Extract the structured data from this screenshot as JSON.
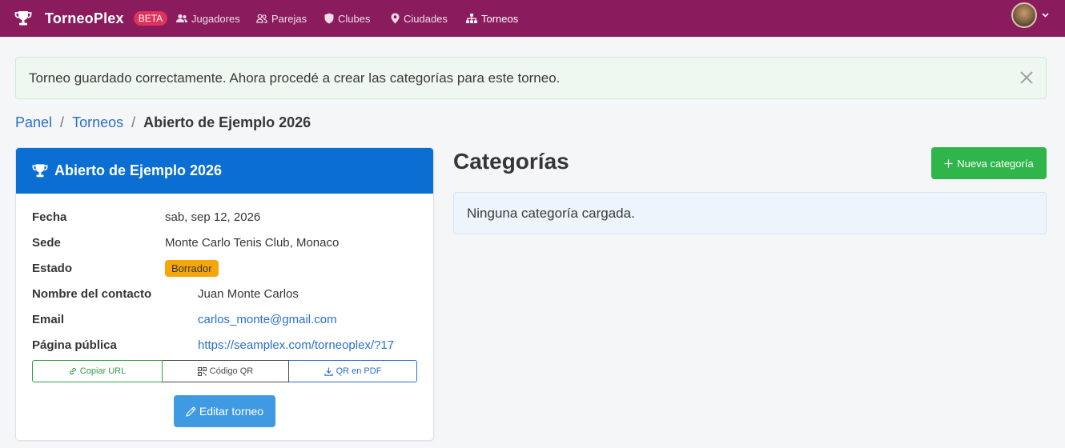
{
  "navbar": {
    "brand": "TorneoPlex",
    "beta": "BETA",
    "items": [
      {
        "label": "Jugadores",
        "icon": "users-icon"
      },
      {
        "label": "Parejas",
        "icon": "user-pair-icon"
      },
      {
        "label": "Clubes",
        "icon": "shield-icon"
      },
      {
        "label": "Ciudades",
        "icon": "map-pin-icon"
      },
      {
        "label": "Torneos",
        "icon": "sitemap-icon"
      }
    ],
    "colors": {
      "bar": "#8a1c5e",
      "beta": "#e0325c"
    }
  },
  "alert": {
    "message": "Torneo guardado correctamente. Ahora procedé a crear las categorías para este torneo."
  },
  "breadcrumb": {
    "items": [
      "Panel",
      "Torneos"
    ],
    "separator": "/",
    "current": "Abierto de Ejemplo 2026"
  },
  "tournament": {
    "title": "Abierto de Ejemplo 2026",
    "fields": {
      "fecha": {
        "label": "Fecha",
        "value": "sab, sep 12, 2026"
      },
      "sede": {
        "label": "Sede",
        "value": "Monte Carlo Tenis Club, Monaco"
      },
      "estado": {
        "label": "Estado",
        "value": "Borrador"
      },
      "contacto": {
        "label": "Nombre del contacto",
        "value": "Juan Monte Carlos"
      },
      "email": {
        "label": "Email",
        "value": "carlos_monte@gmail.com"
      },
      "pagina": {
        "label": "Página pública",
        "value": "https://seamplex.com/torneoplex/?17"
      }
    },
    "actions": {
      "copy_url": "Copiar URL",
      "qr_code": "Código QR",
      "qr_pdf": "QR en PDF",
      "edit": "Editar torneo"
    },
    "colors": {
      "header": "#0b6ed2",
      "badge": "#f5a70a",
      "edit": "#3f9ae3"
    }
  },
  "categories": {
    "title": "Categorías",
    "new_button": "Nueva categoría",
    "empty": "Ninguna categoría cargada.",
    "colors": {
      "new_button": "#2fb54a"
    }
  }
}
